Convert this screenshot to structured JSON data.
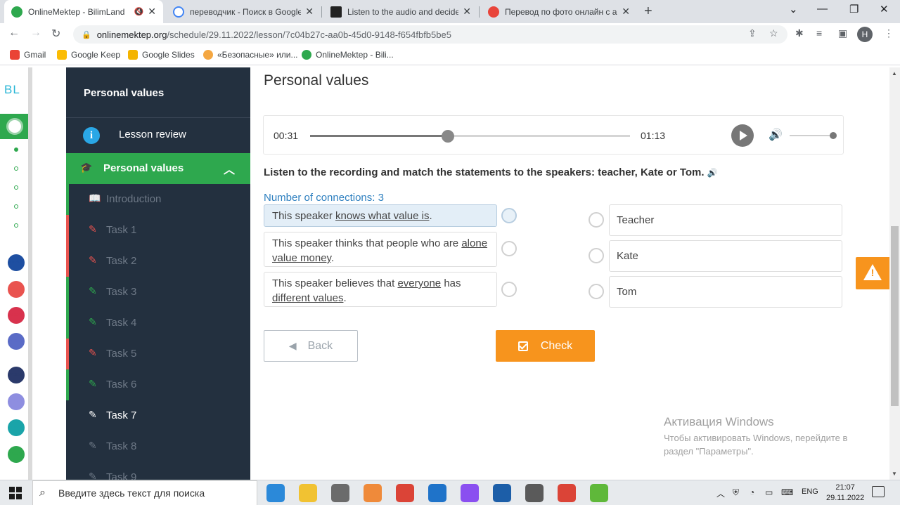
{
  "browser": {
    "tabs": [
      {
        "title": "OnlineMektep - BilimLand",
        "favicon": "onlinemektep-icon",
        "active": true,
        "muted_icon": "🔇"
      },
      {
        "title": "переводчик - Поиск в Google",
        "favicon": "google-icon",
        "active": false
      },
      {
        "title": "Listen to the audio and decide if",
        "favicon": "listen-site-icon",
        "active": false
      },
      {
        "title": "Перевод по фото онлайн с англ",
        "favicon": "photo-translate-icon",
        "active": false
      }
    ],
    "close_glyph": "✕",
    "new_tab": "+",
    "window_controls": {
      "dropdown": "⌄",
      "minimize": "—",
      "maximize": "❐",
      "close": "✕"
    },
    "url": {
      "domain": "onlinemektep.org",
      "path": "/schedule/29.11.2022/lesson/7c04b27c-aa0b-45d0-9148-f654fbfb5be5"
    },
    "profile_initial": "H",
    "bookmarks": [
      {
        "label": "Gmail",
        "color": "#ea4335"
      },
      {
        "label": "Google Keep",
        "color": "#fbbc04"
      },
      {
        "label": "Google Slides",
        "color": "#f4b400"
      },
      {
        "label": "«Безопасные» или...",
        "color": "#f4a742"
      },
      {
        "label": "OnlineMektep - Bili...",
        "color": "#2ea84e"
      }
    ]
  },
  "rail": {
    "logo": "BL",
    "apps": [
      {
        "name": "bilim-class-icon",
        "color": "#1e4fa1"
      },
      {
        "name": "bilim-media-icon",
        "color": "#e9534f"
      },
      {
        "name": "bilim-shop-icon",
        "color": "#d8324d"
      },
      {
        "name": "bilim-test-icon",
        "color": "#5a6bc6"
      },
      {
        "name": "smart-nation-icon",
        "color": "#2b3a6b"
      },
      {
        "name": "library-icon",
        "color": "#8e8ee0"
      },
      {
        "name": "bilim-teach-icon",
        "color": "#1aa4a9"
      },
      {
        "name": "bilim-land-icon",
        "color": "#2ea84e"
      }
    ]
  },
  "sidebar": {
    "course_title": "Personal values",
    "lesson_review": "Lesson review",
    "section_title": "Personal values",
    "items": [
      {
        "label": "Introduction",
        "status": "done",
        "bar": "#2ea84e",
        "icon_color": "#2ea84e",
        "icon": "📖"
      },
      {
        "label": "Task 1",
        "status": "wrong",
        "bar": "#e9534f",
        "icon_color": "#e9534f",
        "icon": "✎"
      },
      {
        "label": "Task 2",
        "status": "wrong",
        "bar": "#e9534f",
        "icon_color": "#e9534f",
        "icon": "✎"
      },
      {
        "label": "Task 3",
        "status": "done",
        "bar": "#2ea84e",
        "icon_color": "#2ea84e",
        "icon": "✎"
      },
      {
        "label": "Task 4",
        "status": "done",
        "bar": "#2ea84e",
        "icon_color": "#2ea84e",
        "icon": "✎"
      },
      {
        "label": "Task 5",
        "status": "wrong",
        "bar": "#e9534f",
        "icon_color": "#e9534f",
        "icon": "✎"
      },
      {
        "label": "Task 6",
        "status": "done",
        "bar": "#2ea84e",
        "icon_color": "#2ea84e",
        "icon": "✎"
      },
      {
        "label": "Task 7",
        "status": "current",
        "bar": "",
        "icon_color": "#ffffff",
        "icon": "✎"
      },
      {
        "label": "Task 8",
        "status": "todo",
        "bar": "",
        "icon_color": "#6d7886",
        "icon": "✎"
      },
      {
        "label": "Task 9",
        "status": "todo",
        "bar": "",
        "icon_color": "#6d7886",
        "icon": "✎"
      }
    ]
  },
  "lesson": {
    "title": "Personal values",
    "player": {
      "current_time": "00:31",
      "duration": "01:13",
      "progress": 0.43,
      "volume": 1.0
    },
    "instruction": "Listen to the recording and match the statements to the speakers: teacher, Kate or Tom.",
    "connections_label": "Number of connections: 3",
    "statements": [
      {
        "parts": [
          {
            "t": "This speaker "
          },
          {
            "t": "knows what value is",
            "u": true
          },
          {
            "t": "."
          }
        ],
        "selected": true
      },
      {
        "parts": [
          {
            "t": "This speaker thinks that people who are "
          },
          {
            "t": "alone value money",
            "u": true
          },
          {
            "t": "."
          }
        ],
        "selected": false
      },
      {
        "parts": [
          {
            "t": "This speaker believes that "
          },
          {
            "t": "everyone",
            "u": true
          },
          {
            "t": " has "
          },
          {
            "t": "different values",
            "u": true
          },
          {
            "t": "."
          }
        ],
        "selected": false
      }
    ],
    "answers": [
      "Teacher",
      "Kate",
      "Tom"
    ],
    "back_label": "Back",
    "check_label": "Check"
  },
  "watermark": {
    "title": "Активация Windows",
    "text": "Чтобы активировать Windows, перейдите в раздел \"Параметры\"."
  },
  "taskbar": {
    "search_placeholder": "Введите здесь текст для поиска",
    "language": "ENG",
    "time": "21:07",
    "date": "29.11.2022",
    "apps": [
      {
        "name": "edge-app-icon",
        "color": "#2b89d9"
      },
      {
        "name": "file-explorer-icon",
        "color": "#f1c232"
      },
      {
        "name": "microphone-app-icon",
        "color": "#6b6b6b"
      },
      {
        "name": "telegram-app-icon",
        "color": "#ef8a3a"
      },
      {
        "name": "chrome-app-icon",
        "color": "#db4437"
      },
      {
        "name": "photos-app-icon",
        "color": "#1f73c9"
      },
      {
        "name": "paint3d-app-icon",
        "color": "#8a4ff0"
      },
      {
        "name": "movies-app-icon",
        "color": "#1c5ea8"
      },
      {
        "name": "calculator-app-icon",
        "color": "#5a5a5a"
      },
      {
        "name": "chrome-profile-app-icon",
        "color": "#db4437"
      },
      {
        "name": "green-app-icon",
        "color": "#5fb83a"
      }
    ]
  }
}
